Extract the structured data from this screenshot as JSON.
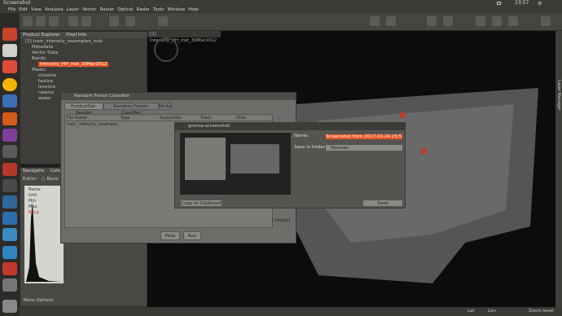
{
  "top": {
    "title": "Screenshot",
    "clock": "23:57"
  },
  "menu": [
    "File",
    "Edit",
    "View",
    "Analysis",
    "Layer",
    "Vector",
    "Raster",
    "Optical",
    "Radar",
    "Tools",
    "Window",
    "Help"
  ],
  "tabs": {
    "product_explorer": "Product Explorer",
    "pixel_info": "Pixel Info",
    "image_tab": "[2] Intensity_HH_mst_30Mar2012"
  },
  "tree": {
    "product": "[2] train_intensity_resampled_msk",
    "metadata": "Metadata",
    "vector_data": "Vector Data",
    "bands": "Bands",
    "selected_band": "Intensity_HH_mst_30Mar2012",
    "masks": "Masks",
    "mask_items": [
      "closeice",
      "fastice",
      "levelice",
      "newice",
      "water"
    ]
  },
  "nav": {
    "navigation": "Navigatio",
    "colour": "Colo",
    "editor": "Editor:",
    "basic": "Basic",
    "labels": [
      "Name",
      "Unit",
      "Min.",
      "Max.",
      "Roug"
    ],
    "more_options": "More Options"
  },
  "rfc": {
    "title": "Random Forest Classifier",
    "tabs": [
      "ProductSet-Reader",
      "Random-Forest-Classifier",
      "Write"
    ],
    "columns": [
      "File Name",
      "Type",
      "Acquisition",
      "Track",
      "Orbit"
    ],
    "row": "train_intensity_resample...",
    "count": "1 Product",
    "help": "Help",
    "run": "Run"
  },
  "gs": {
    "title": "gnome-screenshot",
    "name_label": "Name:",
    "name_value": "Screenshot from 2017-10-24 23:57:42",
    "folder_label": "Save in folder:",
    "folder_value": "Pictures",
    "copy": "Copy to Clipboard",
    "save": "Save"
  },
  "side": {
    "layer_manager": "Layer Manager"
  },
  "status": {
    "lat": "Lat",
    "lon": "Lon",
    "zoom": "Zoom level"
  },
  "colors": {
    "accent": "#e95420",
    "panel": "#3e3d3a",
    "dialog": "#6e6d6a"
  }
}
